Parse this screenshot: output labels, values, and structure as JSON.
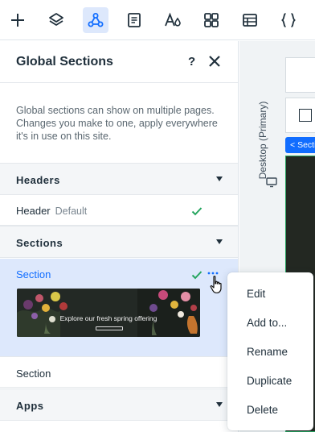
{
  "toolbar": {
    "items": [
      {
        "icon": "plus-icon",
        "active": false
      },
      {
        "icon": "layers-icon",
        "active": false
      },
      {
        "icon": "global-sections-icon",
        "active": true
      },
      {
        "icon": "pages-icon",
        "active": false
      },
      {
        "icon": "theme-icon",
        "active": false
      },
      {
        "icon": "apps-icon",
        "active": false
      },
      {
        "icon": "table-icon",
        "active": false
      },
      {
        "icon": "code-icon",
        "active": false
      }
    ]
  },
  "panel": {
    "title": "Global Sections",
    "help_label": "?",
    "description": "Global sections can show on multiple pages. Changes you make to one, apply everywhere it's in use on this site.",
    "headers_group": {
      "label": "Headers",
      "items": [
        {
          "name": "Header",
          "sub": "Default"
        }
      ]
    },
    "sections_group": {
      "label": "Sections",
      "items": [
        {
          "name": "Section",
          "selected": true,
          "thumb_text": "Explore our fresh spring offering"
        },
        {
          "name": "Section",
          "selected": false
        }
      ]
    },
    "apps_group": {
      "label": "Apps"
    }
  },
  "context_menu": {
    "items": [
      "Edit",
      "Add to...",
      "Rename",
      "Duplicate",
      "Delete"
    ]
  },
  "canvas": {
    "device_label": "Desktop (Primary)",
    "section_tag": "Secti",
    "section_tag_arrow": "<"
  },
  "colors": {
    "accent": "#116dff",
    "check": "#25a55f",
    "selected_bg": "#dde8fc"
  }
}
